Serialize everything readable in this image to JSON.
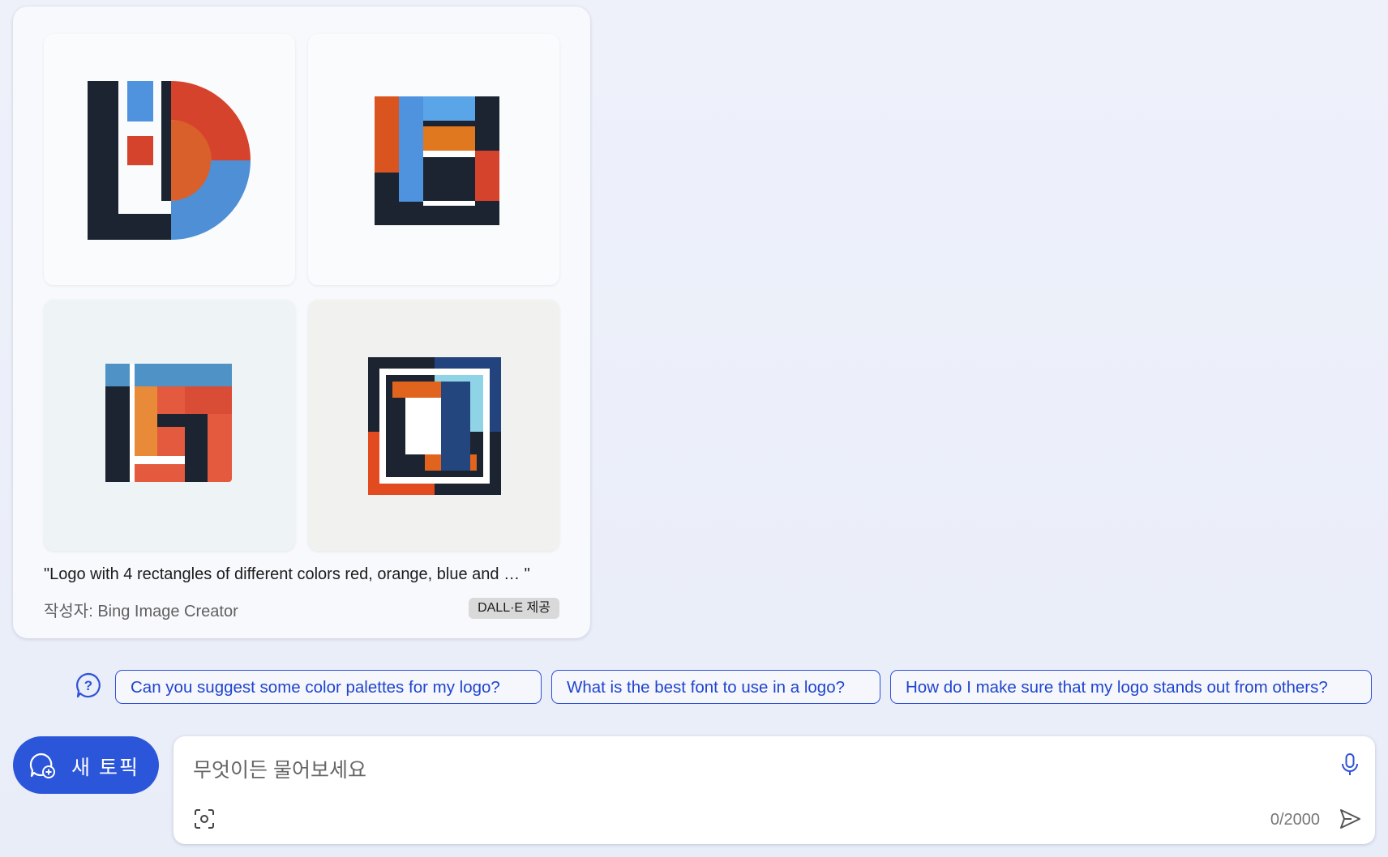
{
  "result_card": {
    "caption": "\"Logo with 4 rectangles of different colors red, orange, blue and … \"",
    "creator": "작성자: Bing Image Creator",
    "badge": "DALL·E 제공",
    "images": [
      {
        "name": "generated-logo-1"
      },
      {
        "name": "generated-logo-2"
      },
      {
        "name": "generated-logo-3"
      },
      {
        "name": "generated-logo-4"
      }
    ]
  },
  "suggestions": [
    "Can you suggest some color palettes for my logo?",
    "What is the best font to use in a logo?",
    "How do I make sure that my logo stands out from others?"
  ],
  "new_topic": {
    "label": "새 토픽"
  },
  "input": {
    "placeholder": "무엇이든 물어보세요",
    "counter": "0/2000"
  },
  "colors": {
    "accent": "#2c56d9",
    "navy": "#1b2430",
    "red": "#d6432c",
    "orange": "#e0702a",
    "blue": "#4f93df"
  },
  "icons": [
    "question-bubble-icon",
    "chat-plus-icon",
    "microphone-icon",
    "visual-search-icon",
    "send-icon"
  ]
}
